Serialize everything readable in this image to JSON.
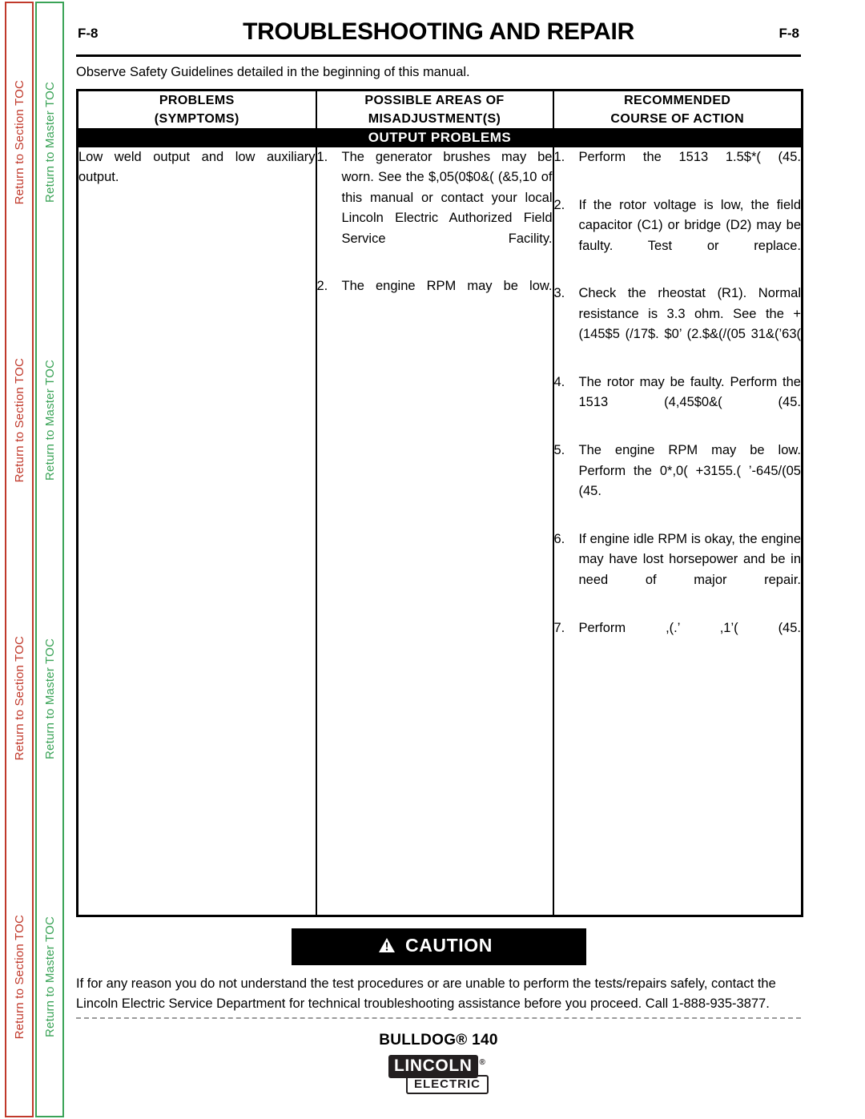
{
  "sidebar": {
    "section_toc_label": "Return to Section TOC",
    "master_toc_label": "Return to Master TOC",
    "section_color": "#c0392b",
    "master_color": "#3aa357",
    "repeat_count": 4
  },
  "header": {
    "page_left": "F-8",
    "page_right": "F-8",
    "title": "TROUBLESHOOTING AND REPAIR",
    "observe_note": "Observe Safety Guidelines detailed in the beginning of this manual."
  },
  "table": {
    "columns": [
      {
        "line1": "PROBLEMS",
        "line2": "(SYMPTOMS)"
      },
      {
        "line1": "POSSIBLE AREAS OF",
        "line2": "MISADJUSTMENT(S)"
      },
      {
        "line1": "RECOMMENDED",
        "line2": "COURSE OF ACTION"
      }
    ],
    "band": "OUTPUT PROBLEMS",
    "rows": [
      {
        "symptom": "Low weld output and low auxiliary output.",
        "misadjustments": [
          {
            "num": "1.",
            "text": "The generator brushes may be worn.  See the $,05(0$0&( (&5,10  of this manual or contact your local Lincoln Electric Authorized Field Service Facility."
          },
          {
            "num": "2.",
            "text": "The engine RPM may be low."
          }
        ],
        "actions": [
          {
            "num": "1.",
            "text": "Perform the 1513 1.5$*( (45."
          },
          {
            "num": "2.",
            "text": "If the rotor voltage is low, the field capacitor (C1) or bridge (D2) may be faulty.  Test or replace."
          },
          {
            "num": "3.",
            "text": "Check the rheostat (R1). Normal resistance is 3.3 ohm. See the +(145$5 (/17$. $0’ (2.$&(/(05 31&(’63("
          },
          {
            "num": "4.",
            "text": "The rotor may be faulty.  Perform the 1513 (4,45$0&( (45."
          },
          {
            "num": "5.",
            "text": "The engine RPM may be low. Perform the 0*,0( +3155.( ’-645/(05 (45."
          },
          {
            "num": "6.",
            "text": "If engine idle RPM is okay, the engine may have lost horsepower and be in need of major repair."
          },
          {
            "num": "7.",
            "text": "Perform ,(.’ ,1’( (45."
          }
        ]
      }
    ]
  },
  "caution": {
    "label": "CAUTION",
    "icon": "warning-triangle-icon",
    "body": "If for any reason you do not understand the test procedures or are unable to perform the tests/repairs safely, contact the Lincoln Electric Service Department for technical troubleshooting assistance before you proceed. Call 1-888-935-3877."
  },
  "footer": {
    "product": "BULLDOG® 140",
    "logo_top": "LINCOLN",
    "logo_reg": "®",
    "logo_bottom": "ELECTRIC"
  }
}
